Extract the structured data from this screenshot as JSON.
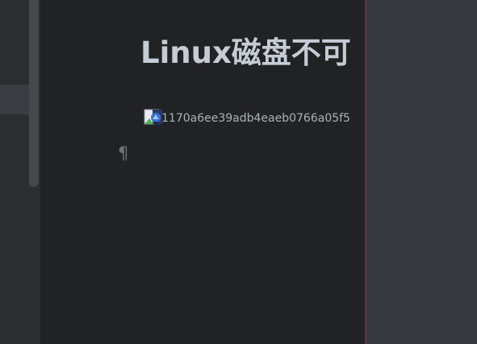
{
  "document": {
    "title": "Linux磁盘不可",
    "image_alt_text": "1170a6ee39adb4eaeb0766a05f5",
    "pilcrow": "¶"
  },
  "icons": {
    "broken_image": "broken-image-icon"
  },
  "colors": {
    "editor_background": "#212224",
    "sidebar_background": "#2b2d30",
    "right_panel_background": "#363a3f",
    "divider": "#6b2c4e",
    "title_text": "#c5ccd6",
    "body_text": "#aab2bd",
    "pilcrow": "#6b7078"
  }
}
